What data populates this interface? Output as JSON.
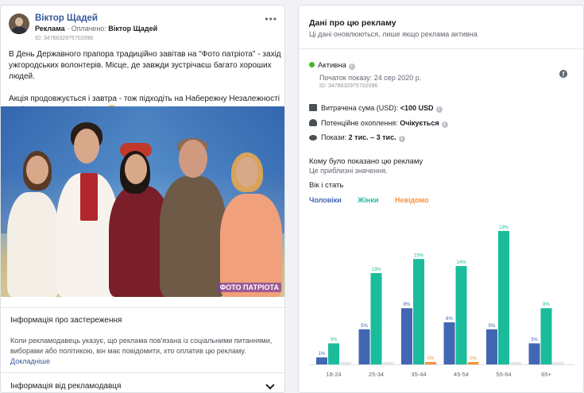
{
  "post": {
    "author": "Віктор Щадей",
    "label_ad": "Реклама",
    "label_paid": "Оплачено: ",
    "paid_by": "Віктор Щадей",
    "id": "ID: 3476632975702096",
    "paragraph1": "В День Державного прапора традиційно завітав на \"Фото патріота\" - захід ужгородських волонтерів. Місце, де завжди зустрічаєш багато хороших людей.",
    "paragraph2": "Акція продовжується і завтра - тож підходіть на Набережну Незалежності до фотозони - там всі свої",
    "photo_watermark": "ФОТО ПАТРІОТА"
  },
  "disclaimer": {
    "title": "Інформація про застереження",
    "body": "Коли рекламодавець указує, що реклама пов'язана із соціальними питаннями, виборами або політикою, він має повідомити, хто оплатив цю рекламу. ",
    "link": "Докладніше"
  },
  "advertiser": {
    "title": "Інформація від рекламодавця"
  },
  "info": {
    "title": "Дані про цю рекламу",
    "subtitle": "Ці дані оновлюються, лише якщо реклама активна",
    "status": "Активна",
    "start": "Початок показу: 24 сер 2020 р.",
    "id": "ID: 3476632975702096",
    "spend_label": "Витрачена сума (USD): ",
    "spend_value": "<100 USD",
    "reach_label": "Потенційне охоплення: ",
    "reach_value": "Очікується",
    "impr_label": "Покази: ",
    "impr_value": "2 тис. – 3 тис.",
    "who_title": "Кому було показано цю рекламу",
    "who_sub": "Це приблизні значення.",
    "age_title": "Вік і стать"
  },
  "colors": {
    "men": "#4267b2",
    "women": "#1abc9c",
    "unknown": "#f7923b"
  },
  "chart_data": {
    "type": "bar",
    "categories": [
      "18-24",
      "25-34",
      "35-44",
      "45-54",
      "55-64",
      "65+"
    ],
    "series": [
      {
        "name": "Чоловіки",
        "values": [
          1,
          5,
          8,
          6,
          5,
          3
        ],
        "labels": [
          "1%",
          "5%",
          "8%",
          "6%",
          "5%",
          "3%"
        ]
      },
      {
        "name": "Жінки",
        "values": [
          3,
          13,
          15,
          14,
          19,
          8
        ],
        "labels": [
          "3%",
          "13%",
          "15%",
          "14%",
          "19%",
          "8%"
        ]
      },
      {
        "name": "Невідомо",
        "values": [
          0,
          0,
          0,
          0,
          0,
          0
        ],
        "labels": [
          "",
          "",
          "0%",
          "0%",
          "",
          ""
        ]
      }
    ],
    "ylim": [
      0,
      20
    ]
  }
}
